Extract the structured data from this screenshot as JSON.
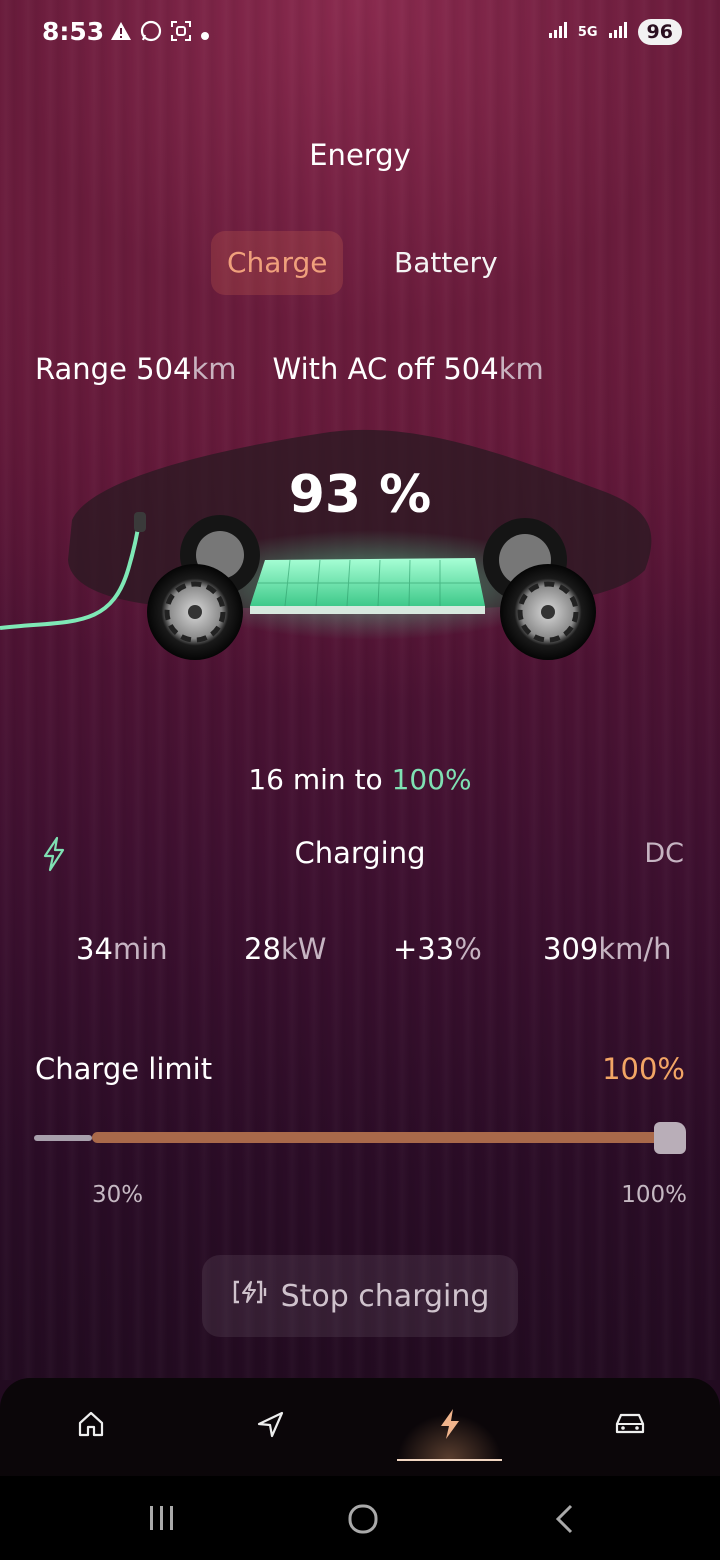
{
  "status_bar": {
    "time": "8:53",
    "battery": "96",
    "network": "5G"
  },
  "header": {
    "title": "Energy"
  },
  "tabs": [
    {
      "label": "Charge",
      "active": true
    },
    {
      "label": "Battery",
      "active": false
    }
  ],
  "range": {
    "label": "Range",
    "value": "504",
    "unit": "km",
    "ac_off_label": "With AC off",
    "ac_off_value": "504",
    "ac_off_unit": "km"
  },
  "battery_percent": "93 %",
  "eta": {
    "text": "16 min to",
    "target": "100%"
  },
  "charging": {
    "status": "Charging",
    "type": "DC"
  },
  "stats": [
    {
      "value": "34",
      "unit": "min"
    },
    {
      "value": "28",
      "unit": "kW"
    },
    {
      "value": "+33",
      "unit": "%"
    },
    {
      "value": "309",
      "unit": "km/h"
    }
  ],
  "charge_limit": {
    "label": "Charge limit",
    "value": "100%",
    "min_label": "30%",
    "max_label": "100%",
    "level": 1.0
  },
  "stop_button": {
    "label": "Stop charging"
  },
  "bottom_nav": [
    {
      "name": "home",
      "active": false
    },
    {
      "name": "navigate",
      "active": false
    },
    {
      "name": "energy",
      "active": true
    },
    {
      "name": "vehicle",
      "active": false
    }
  ],
  "colors": {
    "accent_green": "#7fe0b3",
    "accent_orange": "#f2a565",
    "tab_active": "#f0a07c",
    "slider_fill": "#a9694a"
  }
}
